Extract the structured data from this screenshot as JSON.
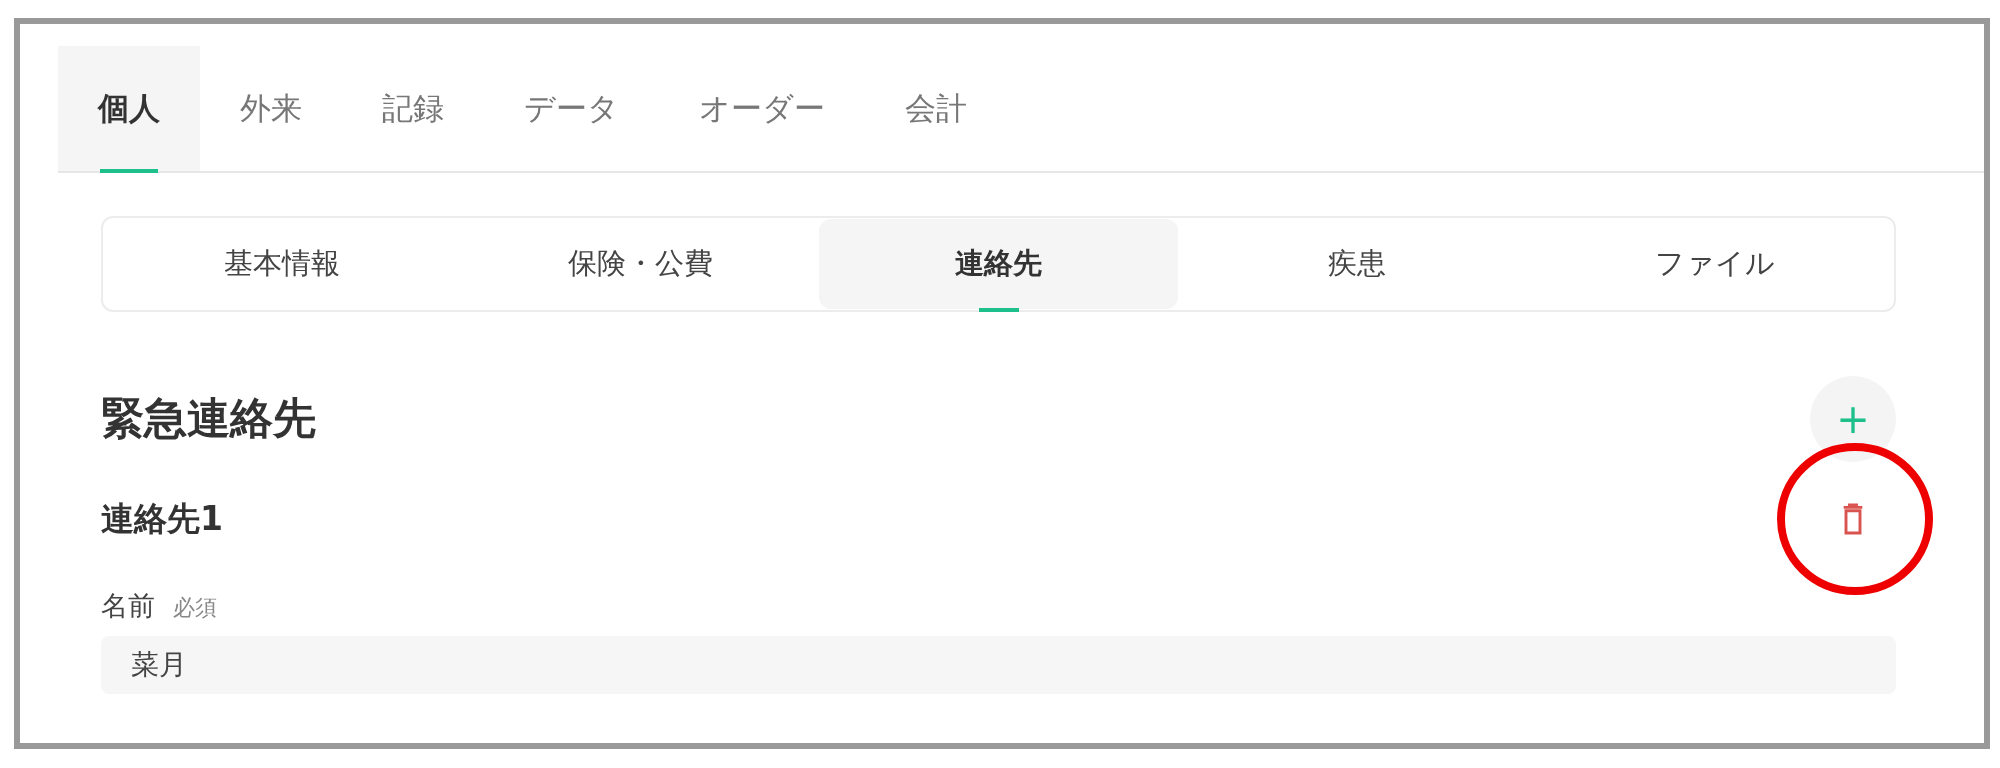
{
  "main_tabs": [
    {
      "label": "個人",
      "selected": true
    },
    {
      "label": "外来",
      "selected": false
    },
    {
      "label": "記録",
      "selected": false
    },
    {
      "label": "データ",
      "selected": false
    },
    {
      "label": "オーダー",
      "selected": false
    },
    {
      "label": "会計",
      "selected": false
    }
  ],
  "sub_tabs": [
    {
      "label": "基本情報",
      "selected": false
    },
    {
      "label": "保険・公費",
      "selected": false
    },
    {
      "label": "連絡先",
      "selected": true
    },
    {
      "label": "疾患",
      "selected": false
    },
    {
      "label": "ファイル",
      "selected": false
    }
  ],
  "section": {
    "title": "緊急連絡先",
    "add_button": "+"
  },
  "contact": {
    "title": "連絡先1",
    "fields": [
      {
        "label": "名前",
        "required_tag": "必須",
        "value": "菜月"
      }
    ]
  }
}
